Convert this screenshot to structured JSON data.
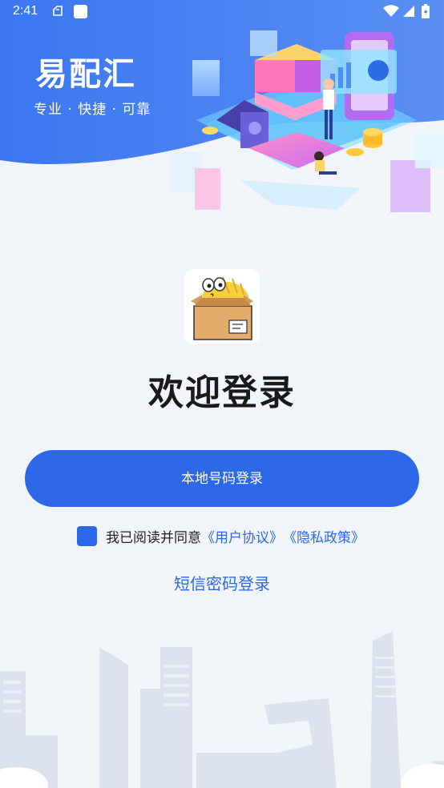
{
  "status_bar": {
    "time": "2:41"
  },
  "brand": {
    "title": "易配汇",
    "slogan": "专业 · 快捷 · 可靠"
  },
  "welcome_title": "欢迎登录",
  "login_button_label": "本地号码登录",
  "agreement": {
    "prefix": "我已阅读并同意",
    "user_agreement": "《用户协议》",
    "privacy_policy": "《隐私政策》"
  },
  "sms_login_label": "短信密码登录",
  "colors": {
    "primary": "#2c68e8",
    "background": "#f1f4f8",
    "hero_blue": "#3f7bf0"
  }
}
